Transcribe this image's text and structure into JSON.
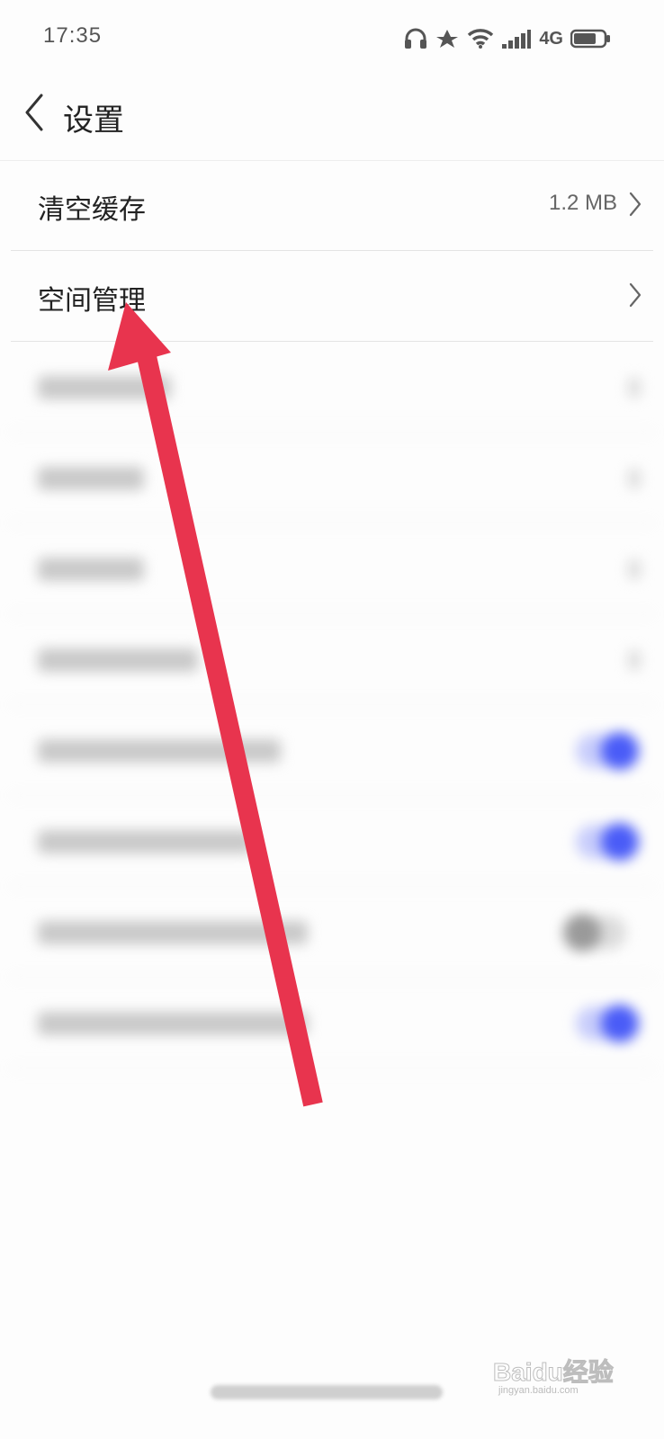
{
  "status_bar": {
    "time": "17:35",
    "network": "4G",
    "icons": [
      "headphones-icon",
      "fan-icon",
      "wifi-icon",
      "signal-icon",
      "battery-icon"
    ]
  },
  "header": {
    "title": "设置",
    "back_icon": "chevron-left-icon"
  },
  "settings": {
    "items": [
      {
        "label": "清空缓存",
        "value": "1.2 MB",
        "type": "link"
      },
      {
        "label": "空间管理",
        "type": "link"
      }
    ],
    "blurred_rows": [
      {
        "type": "link"
      },
      {
        "type": "link"
      },
      {
        "type": "link"
      },
      {
        "type": "link"
      },
      {
        "type": "toggle",
        "state": "on"
      },
      {
        "type": "toggle",
        "state": "on"
      },
      {
        "type": "toggle",
        "state": "off"
      },
      {
        "type": "toggle",
        "state": "on"
      }
    ]
  },
  "annotation": {
    "arrow_color": "#e8344e",
    "points_to": "空间管理"
  },
  "watermark": {
    "brand": "Baidu经验",
    "url": "jingyan.baidu.com"
  },
  "colors": {
    "accent_toggle": "#4a5cf7",
    "background": "#fdfdfd"
  }
}
